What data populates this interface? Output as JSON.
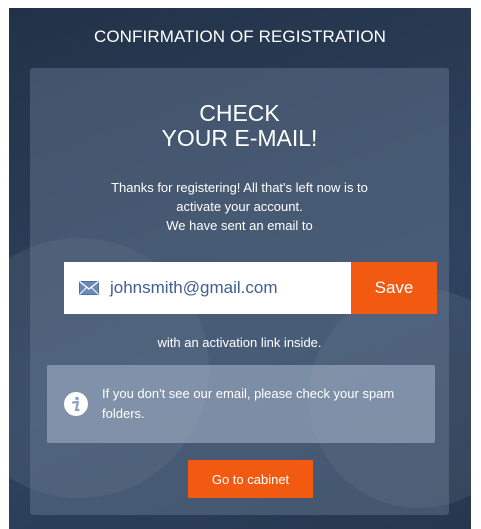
{
  "header": {
    "title": "CONFIRMATION OF REGISTRATION"
  },
  "card": {
    "title_line1": "CHECK",
    "title_line2": "YOUR E-MAIL!",
    "desc_line1": "Thanks for registering! All that's left now is to",
    "desc_line2": "activate your account.",
    "desc_line3": "We have sent an email to",
    "email": {
      "value": "johnsmith@gmail.com",
      "icon": "envelope-icon"
    },
    "save_label": "Save",
    "after_text": "with an activation link inside.",
    "notice": {
      "icon": "info-icon",
      "text": "If you don't see our email, please check your spam folders."
    },
    "cabinet_label": "Go to cabinet"
  },
  "colors": {
    "accent": "#f25a12",
    "background": "#2a3c55",
    "email_text": "#3f5f8e"
  }
}
